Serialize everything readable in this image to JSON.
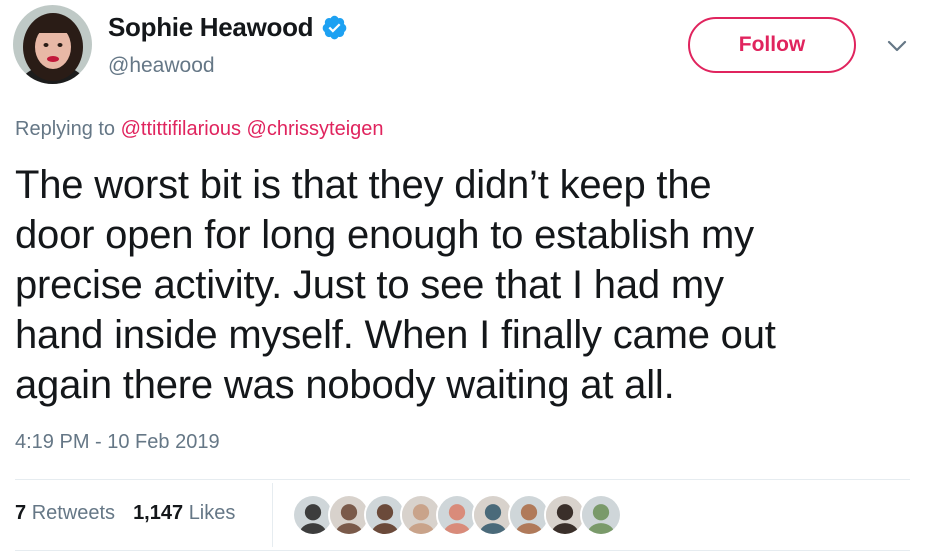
{
  "author": {
    "display_name": "Sophie Heawood",
    "handle": "@heawood",
    "verified": true,
    "avatar_icon": "user-avatar-woman-red-lipstick"
  },
  "follow_label": "Follow",
  "menu_icon": "chevron-down-icon",
  "reply": {
    "prefix": "Replying to",
    "mentions": [
      "@ttittifilarious",
      "@chrissyteigen"
    ]
  },
  "tweet": {
    "lines": [
      "The worst bit is that they didn’t keep the",
      "door open for long enough to establish my",
      "precise activity. Just to see that I had my",
      "hand inside myself. When I finally came out",
      "again there was nobody waiting at all."
    ],
    "timestamp": "4:19 PM - 10 Feb 2019"
  },
  "stats": {
    "retweets_count": "7",
    "retweets_label": "Retweets",
    "likes_count": "1,147",
    "likes_label": "Likes"
  },
  "likers": [
    {
      "icon": "liker-avatar-1",
      "color": "#3d3d3d"
    },
    {
      "icon": "liker-avatar-2",
      "color": "#7a5a4a"
    },
    {
      "icon": "liker-avatar-3",
      "color": "#6b4a3a"
    },
    {
      "icon": "liker-avatar-4",
      "color": "#c9a38a"
    },
    {
      "icon": "liker-avatar-5",
      "color": "#d98b7a"
    },
    {
      "icon": "liker-avatar-6",
      "color": "#4a6a7a"
    },
    {
      "icon": "liker-avatar-7",
      "color": "#b07a5a"
    },
    {
      "icon": "liker-avatar-8",
      "color": "#3a2f2a"
    },
    {
      "icon": "liker-avatar-9",
      "color": "#7a9a6a"
    }
  ],
  "colors": {
    "accent": "#e0245e",
    "verified": "#1da1f2",
    "secondary_text": "#657786",
    "primary_text": "#14171a"
  }
}
